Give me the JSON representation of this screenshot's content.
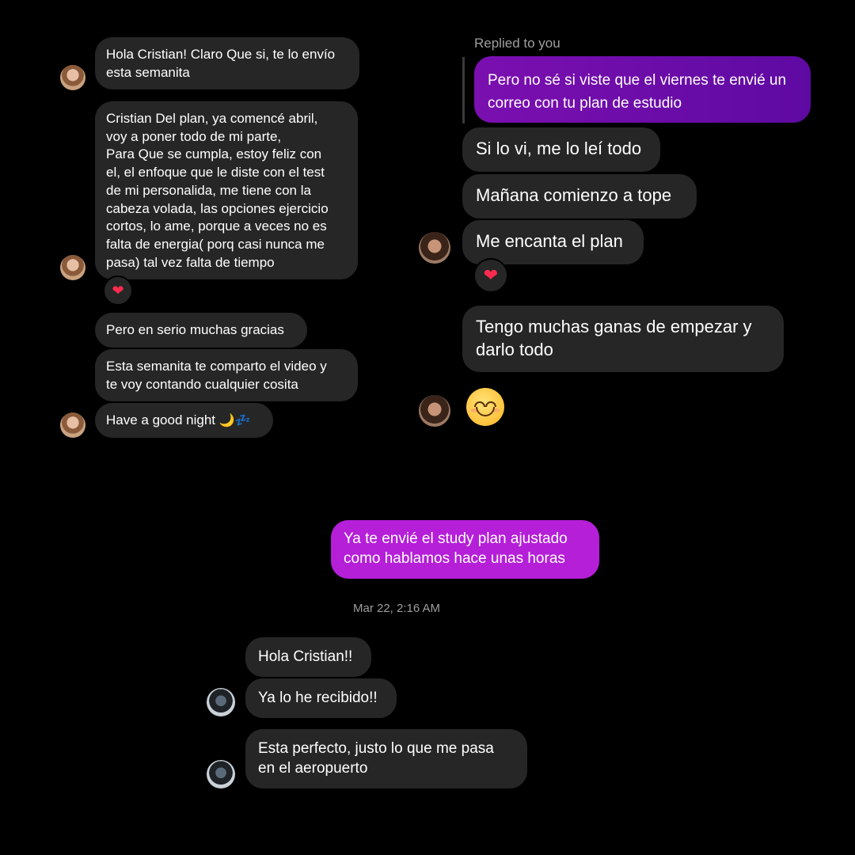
{
  "left_thread": {
    "messages": [
      "Hola Cristian! Claro Que si, te lo envío\nesta semanita",
      "Cristian Del plan, ya comencé abril,\nvoy a poner todo de mi parte,\nPara Que se cumpla, estoy feliz con\nel, el enfoque que le diste con el test\nde mi personalida, me tiene con la\ncabeza volada, las opciones ejercicio\ncortos, lo ame, porque a veces no es\nfalta de energia( porq casi nunca me\npasa) tal vez falta de tiempo",
      "Pero en serio muchas gracias",
      "Esta semanita te comparto el video y\nte voy contando cualquier cosita",
      "Have a good night"
    ],
    "night_emoji": "🌙💤",
    "reaction": "❤"
  },
  "right_thread": {
    "replied_label": "Replied to you",
    "replied_message": "Pero no sé si viste que el viernes te envié un\ncorreo con tu plan de estudio",
    "messages": [
      "Si lo vi, me lo leí todo",
      "Mañana comienzo a tope",
      "Me encanta el plan",
      "Tengo muchas ganas de empezar y\ndarlo todo"
    ],
    "reaction": "❤",
    "smile_emoji": "smiling-face-icon"
  },
  "bottom_thread": {
    "sent_message": "Ya te envié el study plan ajustado\ncomo hablamos hace unas horas",
    "timestamp": "Mar 22, 2:16 AM",
    "messages": [
      "Hola Cristian!!",
      "Ya lo he recibido!!",
      "Esta perfecto, justo lo que me pasa\nen el aeropuerto"
    ]
  },
  "colors": {
    "background": "#000000",
    "received_bubble": "#262626",
    "sent_bubble_reply": "#6a0dad",
    "sent_bubble_bottom": "#b51fd8",
    "meta_text": "#9e9e9e"
  }
}
